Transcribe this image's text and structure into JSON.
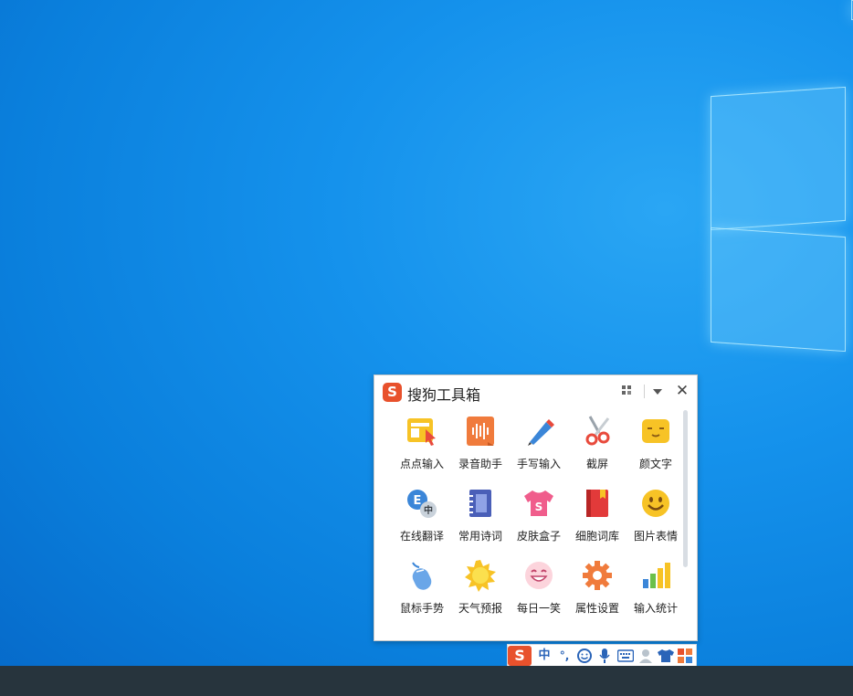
{
  "toolbox": {
    "title": "搜狗工具箱",
    "logo_letter": "S",
    "close_glyph": "✕",
    "tools": [
      {
        "label": "点点输入",
        "icon": "click-input-icon"
      },
      {
        "label": "录音助手",
        "icon": "voice-recorder-icon"
      },
      {
        "label": "手写输入",
        "icon": "pencil-icon"
      },
      {
        "label": "截屏",
        "icon": "scissors-icon"
      },
      {
        "label": "颜文字",
        "icon": "emoticon-icon"
      },
      {
        "label": "在线翻译",
        "icon": "translate-icon"
      },
      {
        "label": "常用诗词",
        "icon": "notebook-icon"
      },
      {
        "label": "皮肤盒子",
        "icon": "tshirt-icon"
      },
      {
        "label": "细胞词库",
        "icon": "book-icon"
      },
      {
        "label": "图片表情",
        "icon": "smiley-icon"
      },
      {
        "label": "鼠标手势",
        "icon": "mouse-icon"
      },
      {
        "label": "天气预报",
        "icon": "sun-icon"
      },
      {
        "label": "每日一笑",
        "icon": "laugh-face-icon"
      },
      {
        "label": "属性设置",
        "icon": "gear-icon"
      },
      {
        "label": "输入统计",
        "icon": "bar-chart-icon"
      }
    ],
    "translate_badge_e": "E",
    "translate_badge_zh": "中",
    "skin_letter": "S"
  },
  "ime_bar": {
    "logo_letter": "S",
    "mode": "中",
    "punct": "°,",
    "items": [
      "mode-icon",
      "punctuation-icon",
      "emoji-icon",
      "microphone-icon",
      "keyboard-icon",
      "user-icon",
      "skin-icon",
      "toolbox-icon"
    ]
  },
  "colors": {
    "accent": "#e8512c",
    "ime_blue": "#2a64b8",
    "taskbar": "#27343d"
  }
}
